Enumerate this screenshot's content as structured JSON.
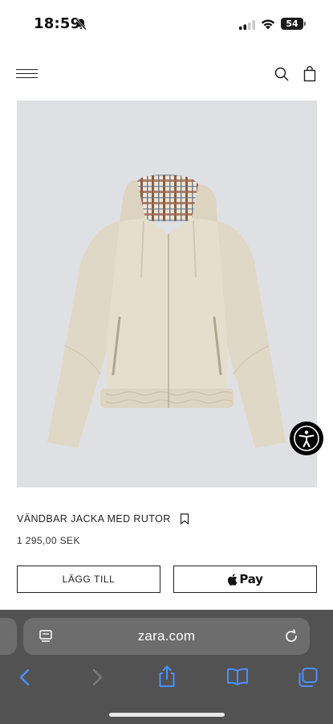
{
  "status_bar": {
    "time": "18:59",
    "battery_level": "54"
  },
  "header": {
    "menu_icon": "hamburger-menu-icon",
    "search_icon": "search-icon",
    "bag_icon": "shopping-bag-icon"
  },
  "product": {
    "image": "reversible-plaid-hooded-jacket-photo",
    "name": "VÄNDBAR JACKA MED RUTOR",
    "price": "1 295,00 SEK",
    "add_label": "LÄGG TILL",
    "applepay_label": "Pay"
  },
  "safari": {
    "address": "zara.com",
    "accent_color": "#4a90ff"
  },
  "colors": {
    "image_background": "#dfe0e3",
    "jacket": "#e4dccb",
    "toolbar": "#525252"
  }
}
